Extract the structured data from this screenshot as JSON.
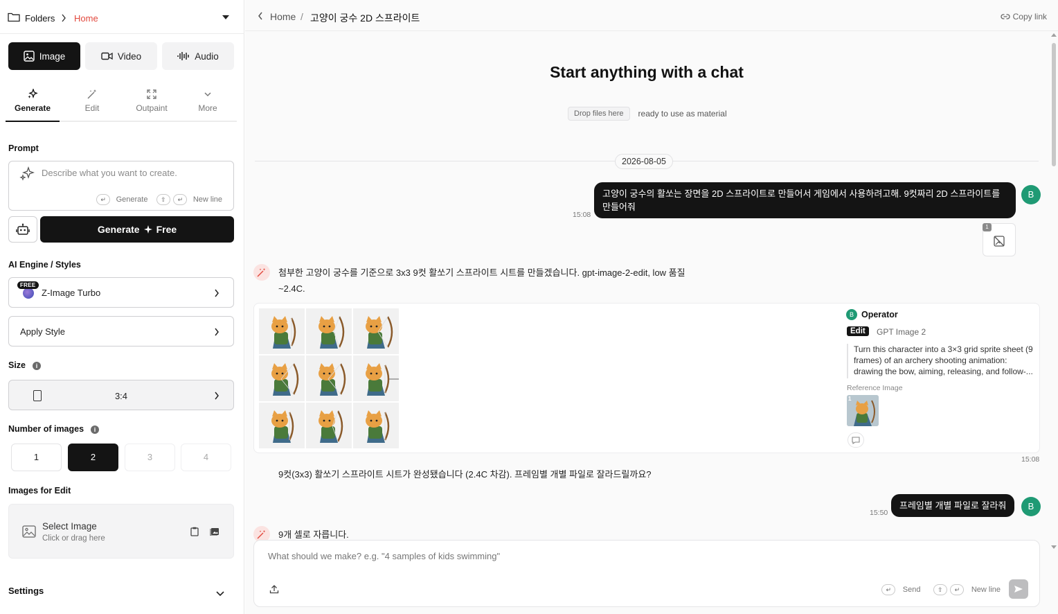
{
  "folderbar": {
    "folders_label": "Folders",
    "current": "Home"
  },
  "media_tabs": [
    {
      "label": "Image",
      "active": true
    },
    {
      "label": "Video",
      "active": false
    },
    {
      "label": "Audio",
      "active": false
    }
  ],
  "sub_tabs": [
    {
      "label": "Generate",
      "icon": "sparkles-icon",
      "active": true
    },
    {
      "label": "Edit",
      "icon": "magic-wand-icon",
      "active": false
    },
    {
      "label": "Outpaint",
      "icon": "expand-icon",
      "active": false
    },
    {
      "label": "More",
      "icon": "chevron-down-icon",
      "active": false
    }
  ],
  "prompt": {
    "label": "Prompt",
    "placeholder": "Describe what you want to create.",
    "hint_generate": "Generate",
    "hint_newline": "New line"
  },
  "generate_button": {
    "label": "Generate",
    "cost": "Free"
  },
  "engine": {
    "label": "AI Engine / Styles",
    "badge": "FREE",
    "name": "Z-Image Turbo",
    "apply_style": "Apply Style"
  },
  "size": {
    "label": "Size",
    "ratio": "3:4"
  },
  "num_images": {
    "label": "Number of images",
    "options": [
      "1",
      "2",
      "3",
      "4"
    ],
    "selected": "2"
  },
  "images_for_edit": {
    "label": "Images for Edit",
    "title": "Select Image",
    "subtitle": "Click or drag here"
  },
  "settings": {
    "label": "Settings"
  },
  "topbar": {
    "home": "Home",
    "separator": "/",
    "title": "고양이 궁수 2D 스프라이트",
    "copy_link": "Copy link"
  },
  "hero": {
    "title": "Start anything with a chat",
    "drop_pill": "Drop files here",
    "drop_text": "ready to use as material"
  },
  "chat": {
    "date": "2026-08-05",
    "user_avatar": "B",
    "messages": [
      {
        "role": "user",
        "time": "15:08",
        "text_line1": "고양이 궁수의 활쏘는 장면을 2D 스프라이트로 만들어서 게임에서 사용하려고해. 9컷짜리 2D 스프라이트를",
        "text_line2": "만들어줘",
        "attachment_count": "1"
      },
      {
        "role": "assistant",
        "text_line1": "첨부한 고양이 궁수를 기준으로 3x3 9컷 활쏘기 스프라이트 시트를 만들겠습니다. gpt-image-2-edit, low 품질",
        "text_line2": "~2.4C."
      },
      {
        "role": "result",
        "time": "15:08"
      },
      {
        "role": "assistant",
        "text": "9컷(3x3) 활쏘기 스프라이트 시트가 완성됐습니다 (2.4C 차감). 프레임별 개별 파일로 잘라드릴까요?"
      },
      {
        "role": "user",
        "time": "15:50",
        "text": "프레임별 개별 파일로 잘라줘"
      },
      {
        "role": "assistant",
        "text": "9개 셀로 자릅니다."
      }
    ]
  },
  "result_card": {
    "operator_avatar": "B",
    "operator": "Operator",
    "tag": "Edit",
    "model": "GPT Image 2",
    "description": "Turn this character into a 3×3 grid sprite sheet (9 frames) of an archery shooting animation: drawing the bow, aiming, releasing, and follow-...",
    "reference_label": "Reference Image",
    "reference_index": "1",
    "cell_bg": "#f1f1f1"
  },
  "composer": {
    "placeholder": "What should we make? e.g. \"4 samples of kids swimming\"",
    "hint_send": "Send",
    "hint_newline": "New line"
  },
  "colors": {
    "accent_red": "#e2483d",
    "dark": "#141414",
    "avatar_green": "#1f9a74"
  }
}
